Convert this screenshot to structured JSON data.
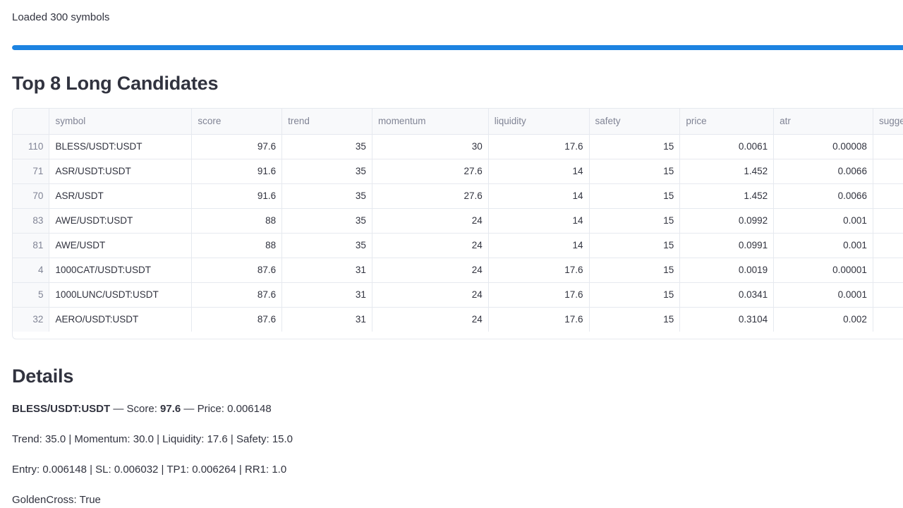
{
  "status": {
    "text": "Loaded 300 symbols",
    "progress_fraction": 1.0,
    "accent_color": "#1c83e1"
  },
  "top_section": {
    "title": "Top 8 Long Candidates"
  },
  "table": {
    "columns": [
      "symbol",
      "score",
      "trend",
      "momentum",
      "liquidity",
      "safety",
      "price",
      "atr",
      "sugge"
    ],
    "rows": [
      {
        "index": "110",
        "symbol": "BLESS/USDT:USDT",
        "score": "97.6",
        "trend": "35",
        "momentum": "30",
        "liquidity": "17.6",
        "safety": "15",
        "price": "0.0061",
        "atr": "0.00008"
      },
      {
        "index": "71",
        "symbol": "ASR/USDT:USDT",
        "score": "91.6",
        "trend": "35",
        "momentum": "27.6",
        "liquidity": "14",
        "safety": "15",
        "price": "1.452",
        "atr": "0.0066"
      },
      {
        "index": "70",
        "symbol": "ASR/USDT",
        "score": "91.6",
        "trend": "35",
        "momentum": "27.6",
        "liquidity": "14",
        "safety": "15",
        "price": "1.452",
        "atr": "0.0066"
      },
      {
        "index": "83",
        "symbol": "AWE/USDT:USDT",
        "score": "88",
        "trend": "35",
        "momentum": "24",
        "liquidity": "14",
        "safety": "15",
        "price": "0.0992",
        "atr": "0.001"
      },
      {
        "index": "81",
        "symbol": "AWE/USDT",
        "score": "88",
        "trend": "35",
        "momentum": "24",
        "liquidity": "14",
        "safety": "15",
        "price": "0.0991",
        "atr": "0.001"
      },
      {
        "index": "4",
        "symbol": "1000CAT/USDT:USDT",
        "score": "87.6",
        "trend": "31",
        "momentum": "24",
        "liquidity": "17.6",
        "safety": "15",
        "price": "0.0019",
        "atr": "0.00001"
      },
      {
        "index": "5",
        "symbol": "1000LUNC/USDT:USDT",
        "score": "87.6",
        "trend": "31",
        "momentum": "24",
        "liquidity": "17.6",
        "safety": "15",
        "price": "0.0341",
        "atr": "0.0001"
      },
      {
        "index": "32",
        "symbol": "AERO/USDT:USDT",
        "score": "87.6",
        "trend": "31",
        "momentum": "24",
        "liquidity": "17.6",
        "safety": "15",
        "price": "0.3104",
        "atr": "0.002"
      }
    ]
  },
  "details": {
    "title": "Details",
    "header": {
      "symbol": "BLESS/USDT:USDT",
      "sep1": " — Score: ",
      "score": "97.6",
      "sep2": " — Price: 0.006148"
    },
    "line2": "Trend: 35.0 | Momentum: 30.0 | Liquidity: 17.6 | Safety: 15.0",
    "line3": "Entry: 0.006148 | SL: 0.006032 | TP1: 0.006264 | RR1: 1.0",
    "line4": "GoldenCross: True"
  }
}
